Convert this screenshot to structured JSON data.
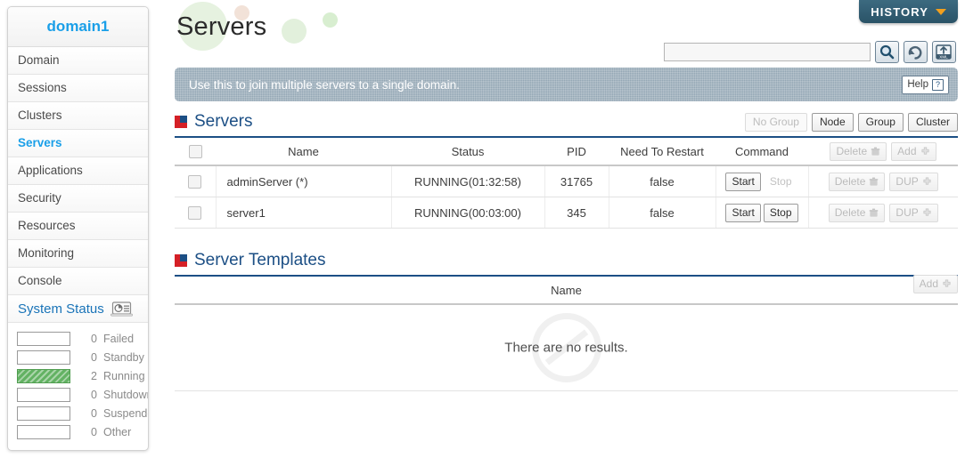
{
  "sidebar": {
    "domain_name": "domain1",
    "items": [
      {
        "label": "Domain",
        "active": false
      },
      {
        "label": "Sessions",
        "active": false
      },
      {
        "label": "Clusters",
        "active": false
      },
      {
        "label": "Servers",
        "active": true
      },
      {
        "label": "Applications",
        "active": false
      },
      {
        "label": "Security",
        "active": false
      },
      {
        "label": "Resources",
        "active": false
      },
      {
        "label": "Monitoring",
        "active": false
      },
      {
        "label": "Console",
        "active": false
      }
    ],
    "system_status": {
      "title": "System Status",
      "icon": "laptop-chart-icon",
      "rows": [
        {
          "count": "0",
          "label": "Failed",
          "filled": false
        },
        {
          "count": "0",
          "label": "Standby",
          "filled": false
        },
        {
          "count": "2",
          "label": "Running",
          "filled": true
        },
        {
          "count": "0",
          "label": "Shutdown",
          "filled": false
        },
        {
          "count": "0",
          "label": "Suspended",
          "filled": false
        },
        {
          "count": "0",
          "label": "Other",
          "filled": false
        }
      ]
    }
  },
  "header": {
    "page_title": "Servers",
    "history_label": "HISTORY",
    "history_chevron_color": "#f2a01e"
  },
  "search": {
    "value": "",
    "placeholder": "",
    "buttons": [
      {
        "name": "search-icon",
        "title": "Search"
      },
      {
        "name": "refresh-icon",
        "title": "Refresh"
      },
      {
        "name": "xml-upload-icon",
        "title": "XML"
      }
    ]
  },
  "info_banner": {
    "text": "Use this to join multiple servers to a single domain.",
    "help_label": "Help",
    "background": "#93a6b4"
  },
  "servers_section": {
    "title": "Servers",
    "view_buttons": [
      {
        "label": "No Group",
        "disabled": true
      },
      {
        "label": "Node",
        "disabled": false
      },
      {
        "label": "Group",
        "disabled": false
      },
      {
        "label": "Cluster",
        "disabled": false
      }
    ],
    "columns": [
      "Name",
      "Status",
      "PID",
      "Need To Restart",
      "Command"
    ],
    "header_actions": [
      {
        "label": "Delete",
        "icon": "trash-icon",
        "disabled": true
      },
      {
        "label": "Add",
        "icon": "plus-icon",
        "disabled": true
      }
    ],
    "rows": [
      {
        "name": "adminServer (*)",
        "status": "RUNNING(01:32:58)",
        "pid": "31765",
        "need_to_restart": "false",
        "start_label": "Start",
        "start_disabled": false,
        "stop_label": "Stop",
        "stop_disabled": true,
        "delete_label": "Delete",
        "delete_disabled": true,
        "dup_label": "DUP",
        "dup_disabled": true
      },
      {
        "name": "server1",
        "status": "RUNNING(00:03:00)",
        "pid": "345",
        "need_to_restart": "false",
        "start_label": "Start",
        "start_disabled": false,
        "stop_label": "Stop",
        "stop_disabled": false,
        "delete_label": "Delete",
        "delete_disabled": true,
        "dup_label": "DUP",
        "dup_disabled": true
      }
    ]
  },
  "templates_section": {
    "title": "Server Templates",
    "column_name": "Name",
    "add_label": "Add",
    "empty_text": "There are no results."
  },
  "colors": {
    "accent_blue": "#1c4f85",
    "link_blue": "#1a9fe8",
    "red": "#d52026",
    "green": "#63b263",
    "banner": "#93a6b4"
  }
}
